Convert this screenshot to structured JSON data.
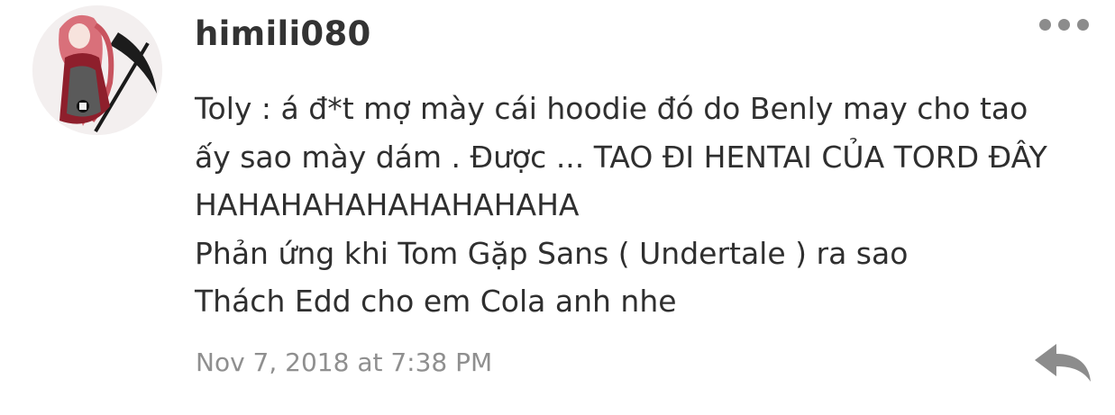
{
  "comment": {
    "username": "himili080",
    "body_lines": [
      "Toly : á đ*t mợ mày cái hoodie đó do Benly may cho tao",
      "ấy sao mày dám . Được ... TAO ĐI HENTAI CỦA TORD ĐÂY",
      "HAHAHAHAHAHAHAHAHA",
      "Phản ứng khi Tom Gặp Sans ( Undertale ) ra sao",
      "Thách Edd cho em Cola anh nhe"
    ],
    "timestamp": "Nov 7, 2018 at 7:38 PM"
  },
  "icons": {
    "more": "more-options-icon",
    "reply": "reply-arrow-icon"
  },
  "colors": {
    "text": "#2f2f2f",
    "muted": "#8f8f8f",
    "icon": "#8c8c8c"
  }
}
